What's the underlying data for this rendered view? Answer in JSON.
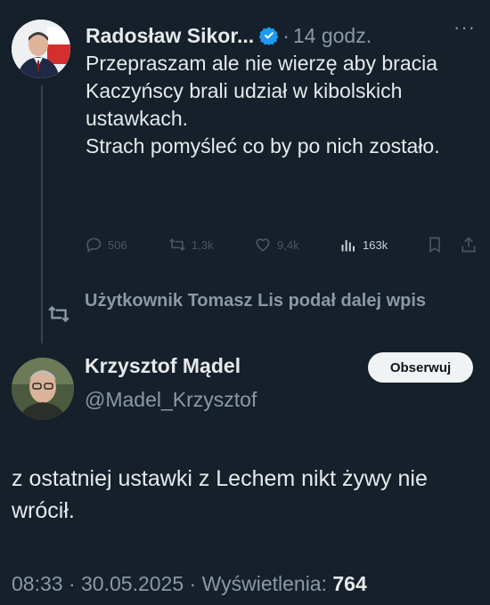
{
  "tweet1": {
    "author_name": "Radosław Sikor...",
    "dot": "·",
    "time": "14 godz.",
    "more": "···",
    "text_lines": [
      "Przepraszam ale nie wierzę aby bracia Kaczyńscy brali udział w kibolskich ustawkach.",
      "Strach pomyśleć co by po nich zostało."
    ],
    "stats": {
      "replies": "506",
      "reposts": "1,3k",
      "likes": "9,4k",
      "views": "163k"
    }
  },
  "retweet_notice": "Użytkownik Tomasz Lis podał dalej wpis",
  "tweet2": {
    "author_name": "Krzysztof Mądel",
    "handle": "@Madel_Krzysztof",
    "follow_label": "Obserwuj",
    "text": "z ostatniej ustawki z Lechem nikt żywy nie wrócił.",
    "footer": {
      "time": "08:33",
      "sep1": " · ",
      "date": "30.05.2025",
      "sep2": " · ",
      "views_label": "Wyświetlenia:",
      "views": "764"
    }
  },
  "colors": {
    "background": "#15202b",
    "text": "#e7e9ea",
    "muted": "#8b98a5",
    "verified": "#1d9bf0"
  }
}
